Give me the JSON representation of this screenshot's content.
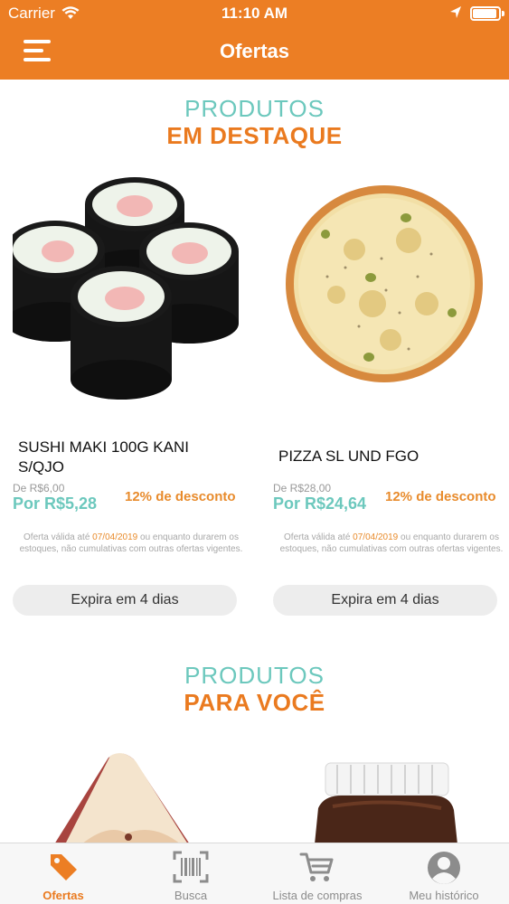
{
  "status_bar": {
    "carrier": "Carrier",
    "time": "11:10 AM"
  },
  "header": {
    "title": "Ofertas",
    "menu_icon": "hamburger-menu-icon"
  },
  "featured": {
    "title_line1": "PRODUTOS",
    "title_line2": "EM DESTAQUE",
    "products": [
      {
        "name": "SUSHI MAKI 100G KANI S/QJO",
        "old_price": "De R$6,00",
        "new_price": "Por R$5,28",
        "discount": "12% de desconto",
        "note_before": "Oferta válida até ",
        "note_date": "07/04/2019",
        "note_after": " ou enquanto durarem os estoques, não cumulativas com outras ofertas vigentes.",
        "expire": "Expira em 4 dias"
      },
      {
        "name": "PIZZA SL UND FGO",
        "old_price": "De R$28,00",
        "new_price": "Por R$24,64",
        "discount": "12% de desconto",
        "note_before": "Oferta válida até ",
        "note_date": "07/04/2019",
        "note_after": " ou enquanto durarem os estoques, não cumulativas com outras ofertas vigentes.",
        "expire": "Expira em 4 dias"
      }
    ]
  },
  "for_you": {
    "title_line1": "PRODUTOS",
    "title_line2": "PARA VOCÊ"
  },
  "tabbar": {
    "items": [
      {
        "label": "Ofertas",
        "icon": "tag-icon",
        "active": true
      },
      {
        "label": "Busca",
        "icon": "barcode-scan-icon",
        "active": false
      },
      {
        "label": "Lista de compras",
        "icon": "shopping-cart-icon",
        "active": false
      },
      {
        "label": "Meu histórico",
        "icon": "user-avatar-icon",
        "active": false
      }
    ]
  },
  "colors": {
    "brand_orange": "#ec7e24",
    "teal": "#6cc8bd",
    "discount_orange": "#e88b2c"
  }
}
